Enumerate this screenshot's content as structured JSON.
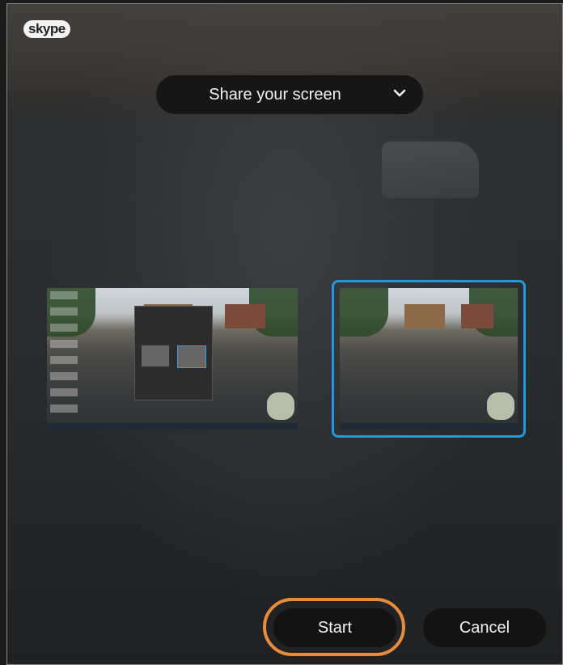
{
  "app": {
    "logo_text": "skype"
  },
  "header": {
    "share_selector_label": "Share your screen",
    "share_selector_icon": "chevron-down-icon"
  },
  "screens": [
    {
      "label": "",
      "selected": false
    },
    {
      "label": "",
      "selected": true
    }
  ],
  "footer": {
    "start_label": "Start",
    "cancel_label": "Cancel"
  },
  "colors": {
    "selection_border": "#1e9be0",
    "highlight_ring": "#e88c3a",
    "pill_bg": "#131313"
  }
}
